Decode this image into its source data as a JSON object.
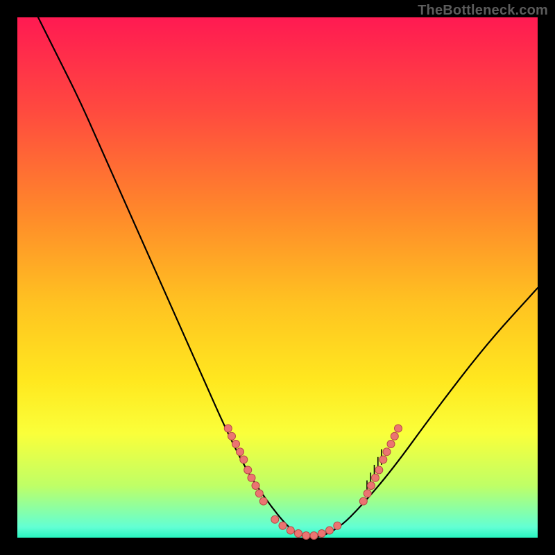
{
  "watermark": "TheBottleneck.com",
  "colors": {
    "background": "#000000",
    "gradient_top": "#ff1a52",
    "gradient_mid": "#ffe81f",
    "gradient_bottom": "#28f5c0",
    "curve_stroke": "#000000",
    "dot_fill": "#eb7471",
    "dot_stroke": "#b74a47"
  },
  "chart_data": {
    "type": "line",
    "title": "",
    "xlabel": "",
    "ylabel": "",
    "xlim": [
      0,
      100
    ],
    "ylim": [
      0,
      100
    ],
    "grid": false,
    "legend": false,
    "series": [
      {
        "name": "bottleneck-curve",
        "x": [
          4,
          8,
          12,
          16,
          20,
          24,
          28,
          32,
          36,
          40,
          44,
          48,
          52,
          55,
          58,
          62,
          66,
          72,
          80,
          90,
          100
        ],
        "y": [
          100,
          92,
          84,
          75,
          66,
          57,
          48,
          39,
          30,
          21,
          13,
          7,
          2,
          0,
          0,
          2,
          6,
          13,
          24,
          37,
          48
        ]
      }
    ],
    "annotations": {
      "dot_clusters": [
        {
          "name": "left-slope-dots",
          "points": [
            {
              "x": 40.5,
              "y": 21
            },
            {
              "x": 41.2,
              "y": 19.5
            },
            {
              "x": 42.0,
              "y": 18
            },
            {
              "x": 42.8,
              "y": 16.5
            },
            {
              "x": 43.5,
              "y": 15
            },
            {
              "x": 44.3,
              "y": 13
            },
            {
              "x": 45.0,
              "y": 11.5
            },
            {
              "x": 45.8,
              "y": 10
            },
            {
              "x": 46.5,
              "y": 8.5
            },
            {
              "x": 47.3,
              "y": 7
            }
          ]
        },
        {
          "name": "valley-floor-dots",
          "points": [
            {
              "x": 49.5,
              "y": 3.5
            },
            {
              "x": 51.0,
              "y": 2.3
            },
            {
              "x": 52.5,
              "y": 1.4
            },
            {
              "x": 54.0,
              "y": 0.8
            },
            {
              "x": 55.5,
              "y": 0.4
            },
            {
              "x": 57.0,
              "y": 0.4
            },
            {
              "x": 58.5,
              "y": 0.8
            },
            {
              "x": 60.0,
              "y": 1.4
            },
            {
              "x": 61.5,
              "y": 2.3
            }
          ]
        },
        {
          "name": "right-slope-dots",
          "points": [
            {
              "x": 66.5,
              "y": 7
            },
            {
              "x": 67.3,
              "y": 8.5
            },
            {
              "x": 68.0,
              "y": 10
            },
            {
              "x": 68.8,
              "y": 11.5
            },
            {
              "x": 69.5,
              "y": 13
            },
            {
              "x": 70.3,
              "y": 15
            },
            {
              "x": 71.0,
              "y": 16.5
            },
            {
              "x": 71.8,
              "y": 18
            },
            {
              "x": 72.5,
              "y": 19.5
            },
            {
              "x": 73.2,
              "y": 21
            }
          ]
        }
      ],
      "tick_marks": [
        {
          "x": 67.2,
          "y_start": 8.0,
          "y_end": 11.0
        },
        {
          "x": 67.9,
          "y_start": 9.5,
          "y_end": 12.5
        },
        {
          "x": 68.6,
          "y_start": 11.0,
          "y_end": 14.0
        },
        {
          "x": 69.3,
          "y_start": 12.5,
          "y_end": 15.5
        },
        {
          "x": 70.0,
          "y_start": 14.0,
          "y_end": 17.0
        }
      ]
    }
  }
}
